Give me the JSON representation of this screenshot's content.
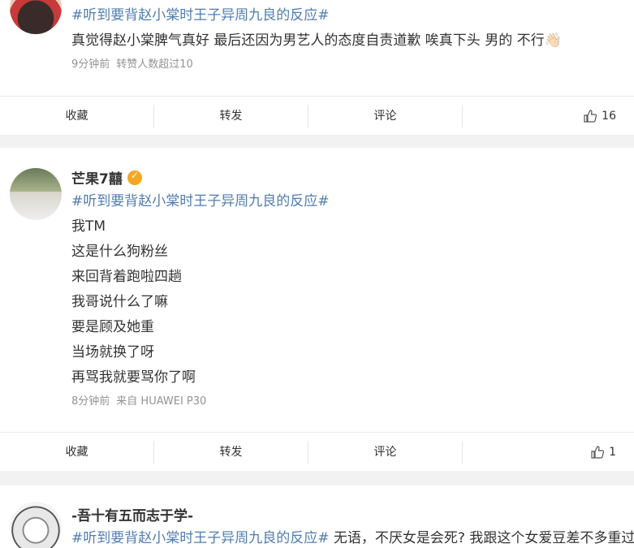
{
  "posts": [
    {
      "username": "",
      "verified": false,
      "lines": [
        {
          "topic": "#听到要背赵小棠时王子异周九良的反应#",
          "text": ""
        },
        {
          "topic": "",
          "text": "真觉得赵小棠脾气真好 最后还因为男艺人的态度自责道歉 唉真下头 男的 不行👋🏻"
        }
      ],
      "meta": [
        "9分钟前",
        "转赞人数超过10"
      ],
      "actions": {
        "collect": "收藏",
        "repost": "转发",
        "comment": "评论",
        "likes": "16"
      }
    },
    {
      "username": "芒果7囍",
      "verified": true,
      "lines": [
        {
          "topic": "#听到要背赵小棠时王子异周九良的反应#",
          "text": ""
        },
        {
          "topic": "",
          "text": "我TM"
        },
        {
          "topic": "",
          "text": "这是什么狗粉丝"
        },
        {
          "topic": "",
          "text": "来回背着跑啦四趟"
        },
        {
          "topic": "",
          "text": "我哥说什么了嘛"
        },
        {
          "topic": "",
          "text": "要是顾及她重"
        },
        {
          "topic": "",
          "text": "当场就换了呀"
        },
        {
          "topic": "",
          "text": "再骂我就要骂你了啊"
        }
      ],
      "meta": [
        "8分钟前",
        "来自 HUAWEI P30"
      ],
      "actions": {
        "collect": "收藏",
        "repost": "转发",
        "comment": "评论",
        "likes": "1"
      }
    },
    {
      "username": "-吾十有五而志于学-",
      "verified": false,
      "lines": [
        {
          "topic": "#听到要背赵小棠时王子异周九良的反应#",
          "text": " 无语，不厌女是会死? 我跟这个女爱豆差不多重过"
        }
      ]
    }
  ],
  "colors": {
    "topic": "#507daf",
    "verified_badge": "#f5a623",
    "meta": "#939393"
  }
}
